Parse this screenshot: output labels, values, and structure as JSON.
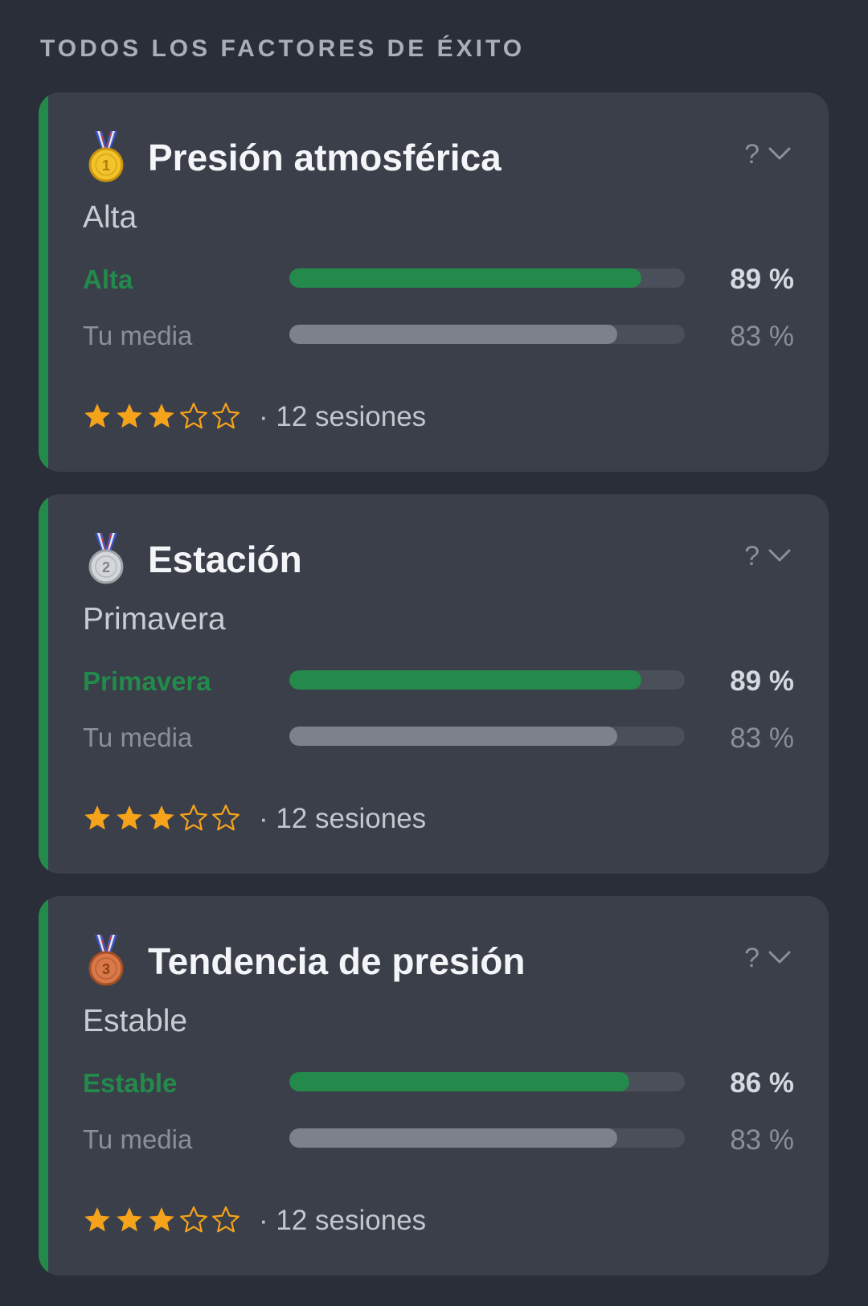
{
  "section_title": "TODOS LOS FACTORES DE ÉXITO",
  "colors": {
    "accent_green": "#238a4b",
    "star": "#f5a31a",
    "avg_bar": "#7c818b"
  },
  "cards": [
    {
      "medal": "gold-medal-icon",
      "medal_number": "1",
      "title": "Presión atmosférica",
      "subtitle": "Alta",
      "help": "?",
      "main_label": "Alta",
      "main_value": "89 %",
      "main_pct": 89,
      "avg_label": "Tu media",
      "avg_value": "83 %",
      "avg_pct": 83,
      "rating": 3,
      "rating_max": 5,
      "sessions": "· 12 sesiones"
    },
    {
      "medal": "silver-medal-icon",
      "medal_number": "2",
      "title": "Estación",
      "subtitle": "Primavera",
      "help": "?",
      "main_label": "Primavera",
      "main_value": "89 %",
      "main_pct": 89,
      "avg_label": "Tu media",
      "avg_value": "83 %",
      "avg_pct": 83,
      "rating": 3,
      "rating_max": 5,
      "sessions": "· 12 sesiones"
    },
    {
      "medal": "bronze-medal-icon",
      "medal_number": "3",
      "title": "Tendencia de presión",
      "subtitle": "Estable",
      "help": "?",
      "main_label": "Estable",
      "main_value": "86 %",
      "main_pct": 86,
      "avg_label": "Tu media",
      "avg_value": "83 %",
      "avg_pct": 83,
      "rating": 3,
      "rating_max": 5,
      "sessions": "· 12 sesiones"
    }
  ]
}
